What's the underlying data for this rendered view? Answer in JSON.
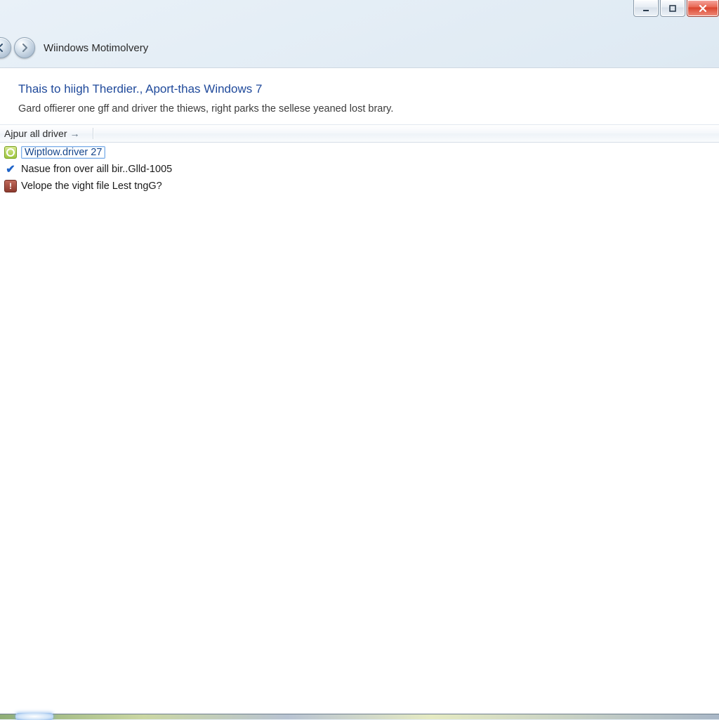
{
  "window": {
    "controls": {
      "minimize": "–",
      "maximize": "❐",
      "close": "✕"
    }
  },
  "breadcrumb": {
    "title": "Wiindows Motimolvery"
  },
  "page": {
    "heading": "Thais to hiigh Therdier., Aport-thas Windows 7",
    "subtext": "Gard offierer one gff and driver the thiews, right parks the sellese yeaned lost brary."
  },
  "column_header": {
    "label": "Ajpur all driver",
    "sort_arrow": "→"
  },
  "items": [
    {
      "icon": "gear",
      "label": "Wiptlow.driver 27",
      "selected": true
    },
    {
      "icon": "check",
      "label": "Nasue fron over aill bir..Glld-1005",
      "selected": false
    },
    {
      "icon": "warn",
      "label": "Velope the vight file Lest tngG?",
      "selected": false
    }
  ]
}
